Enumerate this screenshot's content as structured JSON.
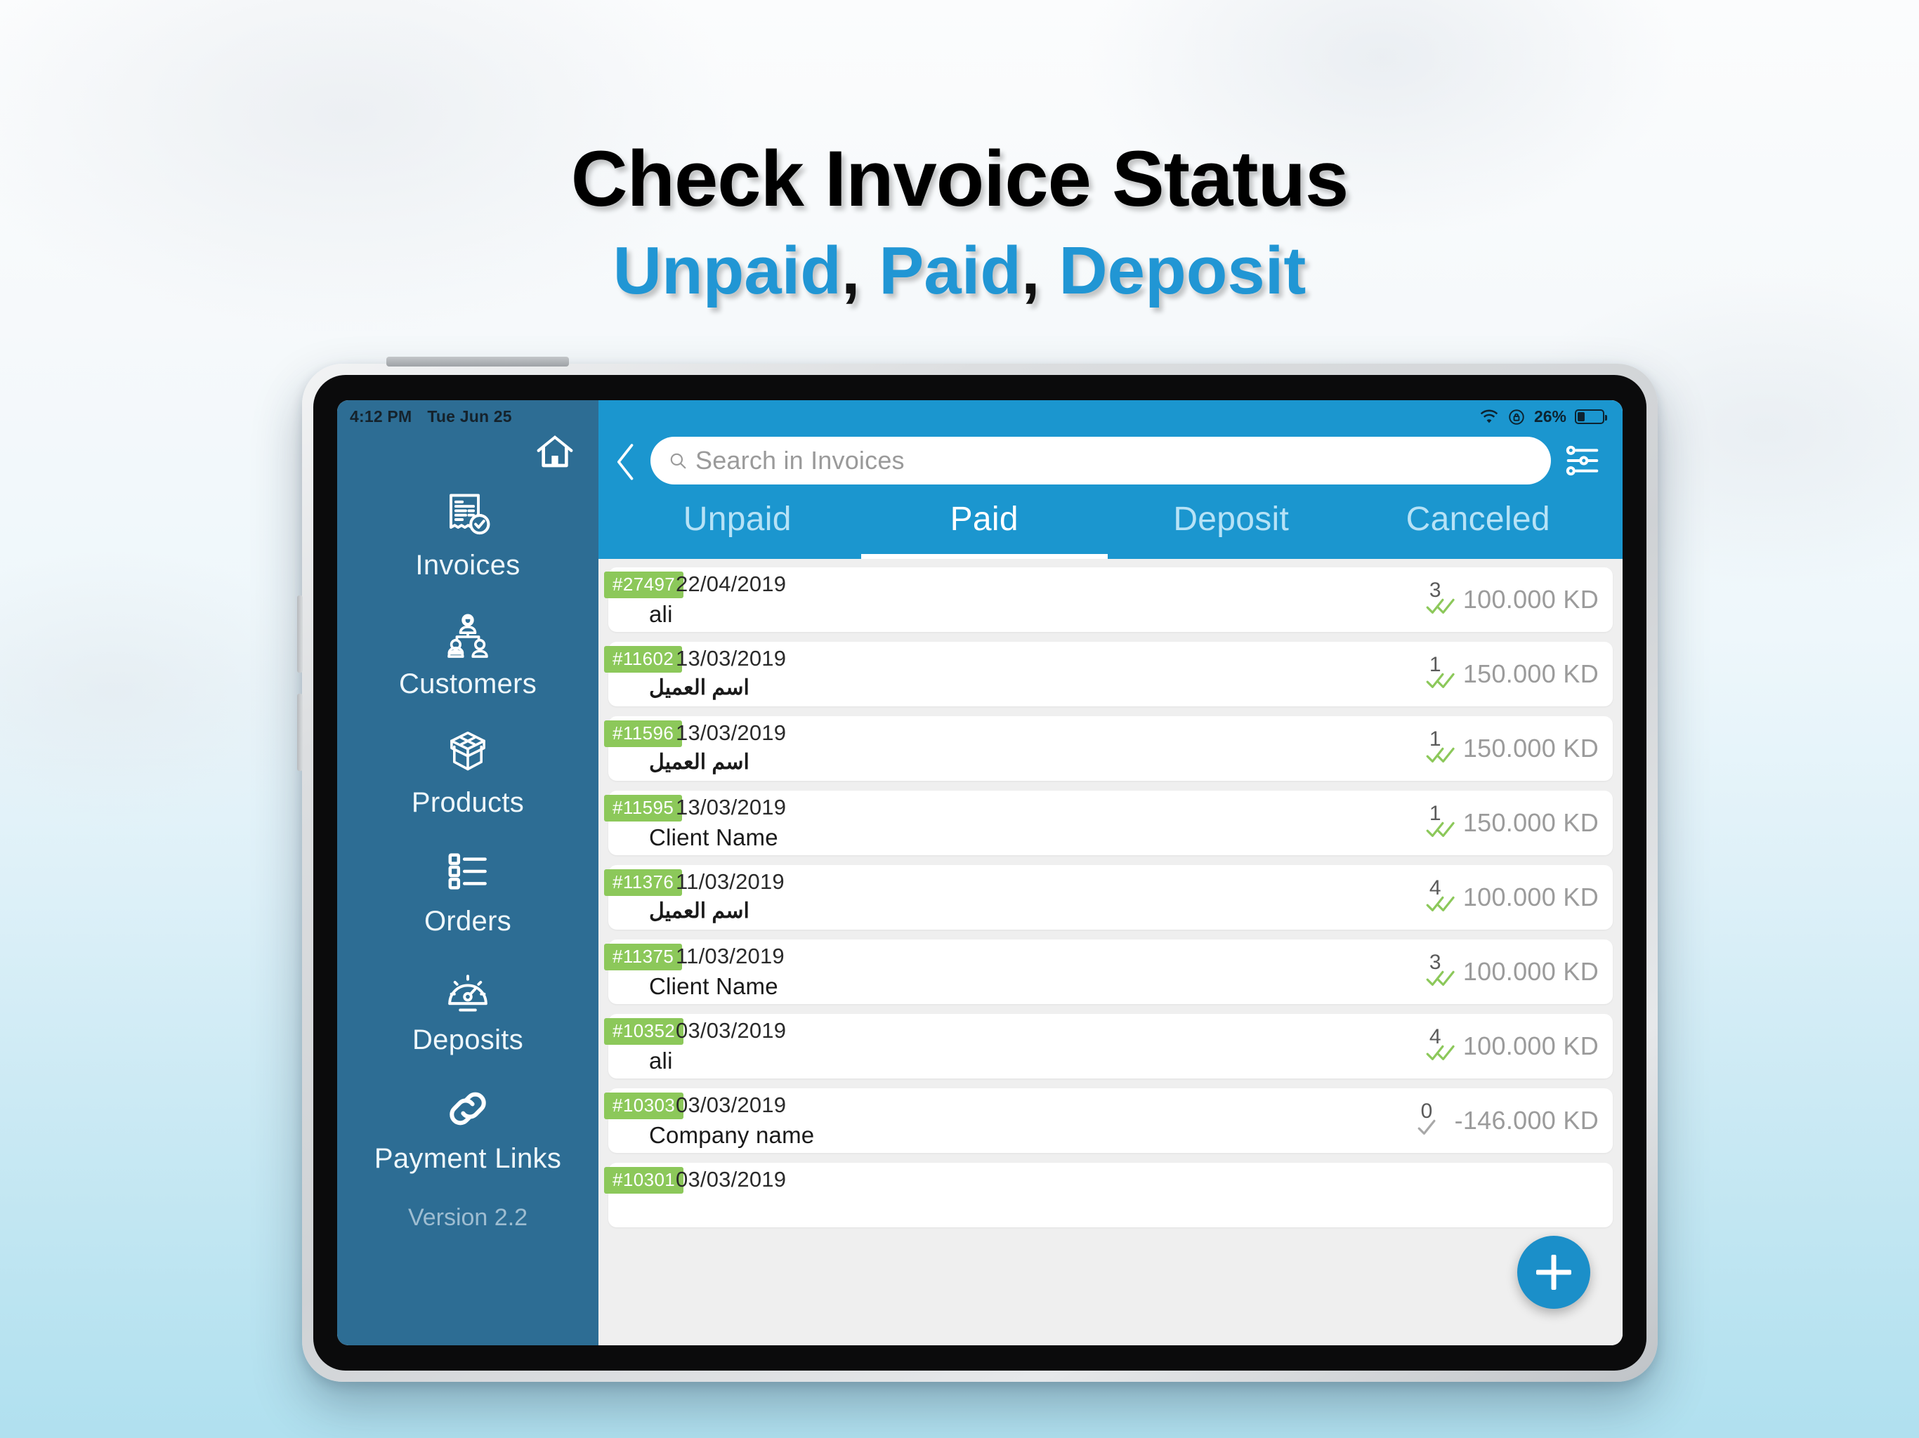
{
  "headline": {
    "line1": "Check Invoice Status",
    "line2_part1": "Unpaid",
    "line2_sep1": ",",
    "line2_part2": "Paid",
    "line2_sep2": ",",
    "line2_part3": "Deposit",
    "accent_color": "#2196d4"
  },
  "status_bar": {
    "time": "4:12 PM",
    "date": "Tue Jun 25",
    "wifi_icon": "wifi-icon",
    "lock_icon": "lock-rotation-icon",
    "battery_percent": "26%",
    "battery_level": 26
  },
  "sidebar": {
    "home_icon": "home-icon",
    "background_color": "#2d6d94",
    "items": [
      {
        "label": "Invoices",
        "icon": "invoice-receipt-check-icon"
      },
      {
        "label": "Customers",
        "icon": "customers-group-icon"
      },
      {
        "label": "Products",
        "icon": "product-box-icon"
      },
      {
        "label": "Orders",
        "icon": "orders-checklist-icon"
      },
      {
        "label": "Deposits",
        "icon": "deposits-gauge-icon"
      },
      {
        "label": "Payment Links",
        "icon": "chain-link-icon"
      }
    ],
    "version": "Version 2.2"
  },
  "topbar": {
    "background_color": "#1b96cf",
    "back_icon": "chevron-left-icon",
    "search": {
      "placeholder": "Search in Invoices",
      "value": "",
      "icon": "search-icon"
    },
    "filter_icon": "filter-sliders-icon"
  },
  "tabs": {
    "active": "Paid",
    "items": [
      {
        "label": "Unpaid",
        "active": false
      },
      {
        "label": "Paid",
        "active": true
      },
      {
        "label": "Deposit",
        "active": false
      },
      {
        "label": "Canceled",
        "active": false
      }
    ]
  },
  "invoice_list": {
    "badge_color": "#8cc85a",
    "rows": [
      {
        "id": "#27497",
        "date": "22/04/2019",
        "client": "ali",
        "rtl": false,
        "count": "3",
        "amount": "100.000 KD",
        "check": "double-check-green"
      },
      {
        "id": "#11602",
        "date": "13/03/2019",
        "client": "اسم العميل",
        "rtl": true,
        "count": "1",
        "amount": "150.000 KD",
        "check": "double-check-green"
      },
      {
        "id": "#11596",
        "date": "13/03/2019",
        "client": "اسم العميل",
        "rtl": true,
        "count": "1",
        "amount": "150.000 KD",
        "check": "double-check-green"
      },
      {
        "id": "#11595",
        "date": "13/03/2019",
        "client": "Client Name",
        "rtl": false,
        "count": "1",
        "amount": "150.000 KD",
        "check": "double-check-green"
      },
      {
        "id": "#11376",
        "date": "11/03/2019",
        "client": "اسم العميل",
        "rtl": true,
        "count": "4",
        "amount": "100.000 KD",
        "check": "double-check-green"
      },
      {
        "id": "#11375",
        "date": "11/03/2019",
        "client": "Client Name",
        "rtl": false,
        "count": "3",
        "amount": "100.000 KD",
        "check": "double-check-green"
      },
      {
        "id": "#10352",
        "date": "03/03/2019",
        "client": "ali",
        "rtl": false,
        "count": "4",
        "amount": "100.000 KD",
        "check": "double-check-green"
      },
      {
        "id": "#10303",
        "date": "03/03/2019",
        "client": "Company name",
        "rtl": false,
        "count": "0",
        "amount": "-146.000 KD",
        "check": "single-check-grey"
      },
      {
        "id": "#10301",
        "date": "03/03/2019",
        "client": "",
        "rtl": false,
        "count": "",
        "amount": "",
        "check": ""
      }
    ]
  },
  "fab": {
    "icon": "plus-icon",
    "color": "#1b8fc9"
  }
}
